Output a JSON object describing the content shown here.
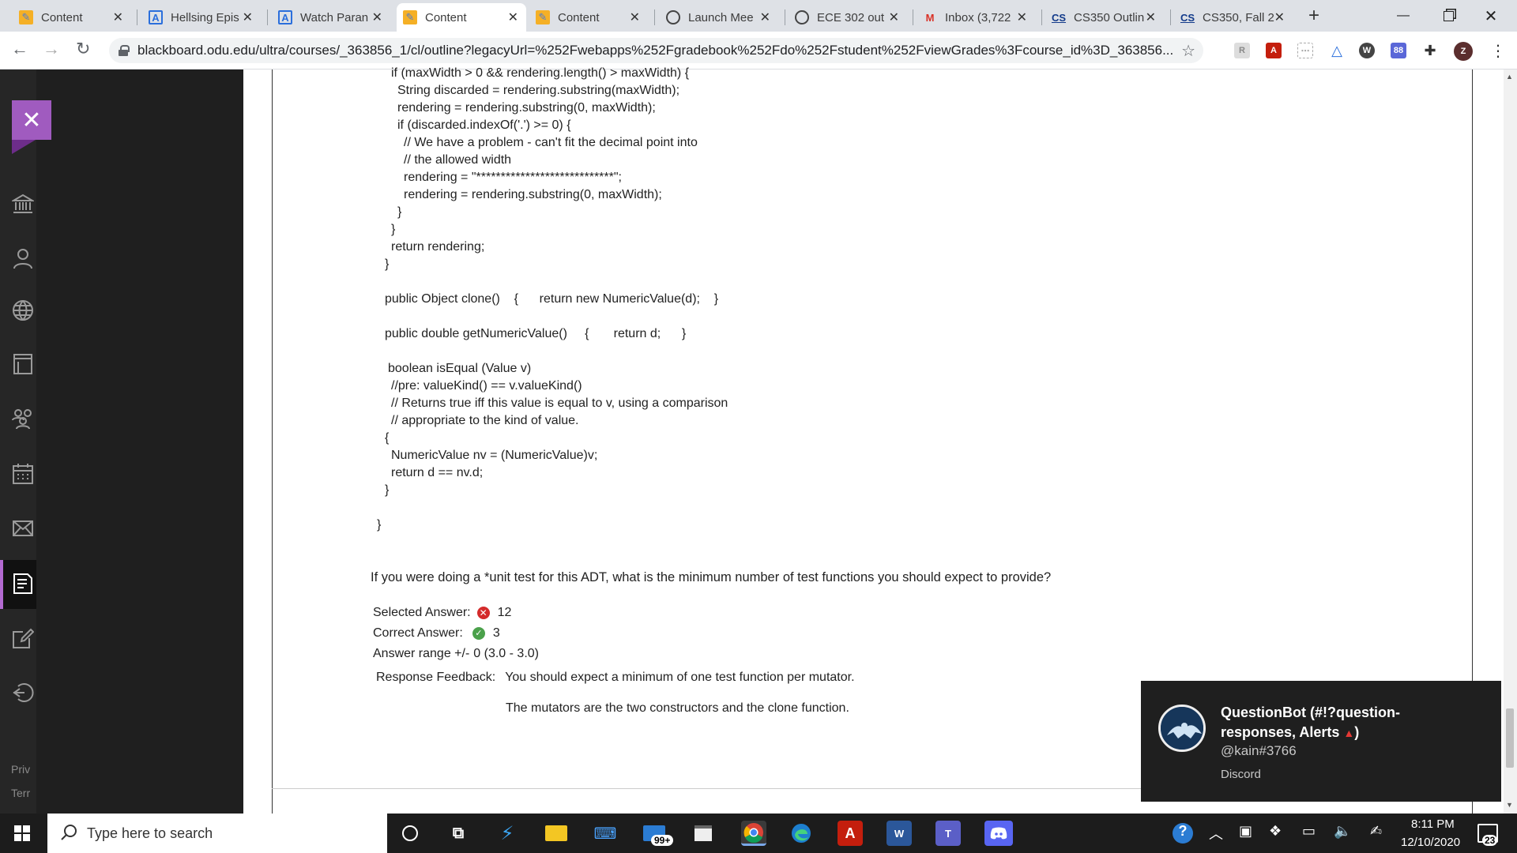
{
  "tabs": [
    {
      "title": "Content",
      "icon": "pencil-icon",
      "active": false
    },
    {
      "title": "Hellsing Epis",
      "icon": "anime-a-icon",
      "active": false
    },
    {
      "title": "Watch Paran",
      "icon": "anime-a-icon",
      "active": false
    },
    {
      "title": "Content",
      "icon": "pencil-icon",
      "active": true
    },
    {
      "title": "Content",
      "icon": "pencil-icon",
      "active": false
    },
    {
      "title": "Launch Mee",
      "icon": "globe-icon",
      "active": false
    },
    {
      "title": "ECE 302 out",
      "icon": "globe-icon",
      "active": false
    },
    {
      "title": "Inbox (3,722",
      "icon": "gmail-icon",
      "active": false
    },
    {
      "title": "CS350 Outlin",
      "icon": "cs-icon",
      "active": false
    },
    {
      "title": "CS350, Fall 2",
      "icon": "cs-icon",
      "active": false
    }
  ],
  "address_bar": {
    "url": "blackboard.odu.edu/ultra/courses/_363856_1/cl/outline?legacyUrl=%252Fwebapps%252Fgradebook%252Fdo%252Fstudent%252FviewGrades%3Fcourse_id%3D_363856..."
  },
  "profile_initial": "Z",
  "sidebar": {
    "icons": [
      "institution-icon",
      "person-icon",
      "globe-icon",
      "courses-icon",
      "groups-icon",
      "calendar-icon",
      "messages-icon",
      "grades-icon",
      "tools-icon",
      "sign-out-icon"
    ],
    "footer_links": [
      "Priv",
      "Terr"
    ]
  },
  "code_lines": [
    "if (maxWidth > 0 && rendering.length() > maxWidth) {",
    "String discarded = rendering.substring(maxWidth);",
    "rendering = rendering.substring(0, maxWidth);",
    "if (discarded.indexOf('.') >= 0) {",
    "// We have a problem - can't fit the decimal point into",
    "// the allowed width",
    "rendering = \"****************************\";",
    "rendering = rendering.substring(0, maxWidth);",
    "}",
    "}",
    "return rendering;",
    "}",
    "public Object clone()    {      return new NumericValue(d);    }",
    "public double getNumericValue()     {       return d;      }",
    "boolean isEqual (Value v)",
    "//pre: valueKind() == v.valueKind()",
    "// Returns true iff this value is equal to v, using a comparison",
    "// appropriate to the kind of value.",
    "{",
    "NumericValue nv = (NumericValue)v;",
    "return d == nv.d;",
    "}",
    "}"
  ],
  "question": {
    "text": "If you were doing a *unit test for this ADT, what is the minimum number of test functions you should expect to provide?",
    "selected_label": "Selected Answer:",
    "selected_value": "12",
    "correct_label": "Correct Answer:",
    "correct_value": "3",
    "range_label": "Answer range +/-",
    "range_value": "0 (3.0 - 3.0)",
    "feedback_label": "Response Feedback:",
    "feedback_line1": "You should expect a minimum of one test function per mutator.",
    "feedback_line2": "The mutators are the two constructors and the clone function."
  },
  "notification": {
    "title_line1": "QuestionBot (#!?question-",
    "title_line2": "responses, Alerts",
    "title_end": ")",
    "user": "@kain#3766",
    "app": "Discord"
  },
  "taskbar": {
    "search_placeholder": "Type here to search",
    "mail_badge": "99+",
    "time": "8:11 PM",
    "date": "12/10/2020",
    "notification_count": "23"
  },
  "colors": {
    "accent": "#a05bbf",
    "wrong": "#d42b2b",
    "right": "#4ba14b"
  }
}
